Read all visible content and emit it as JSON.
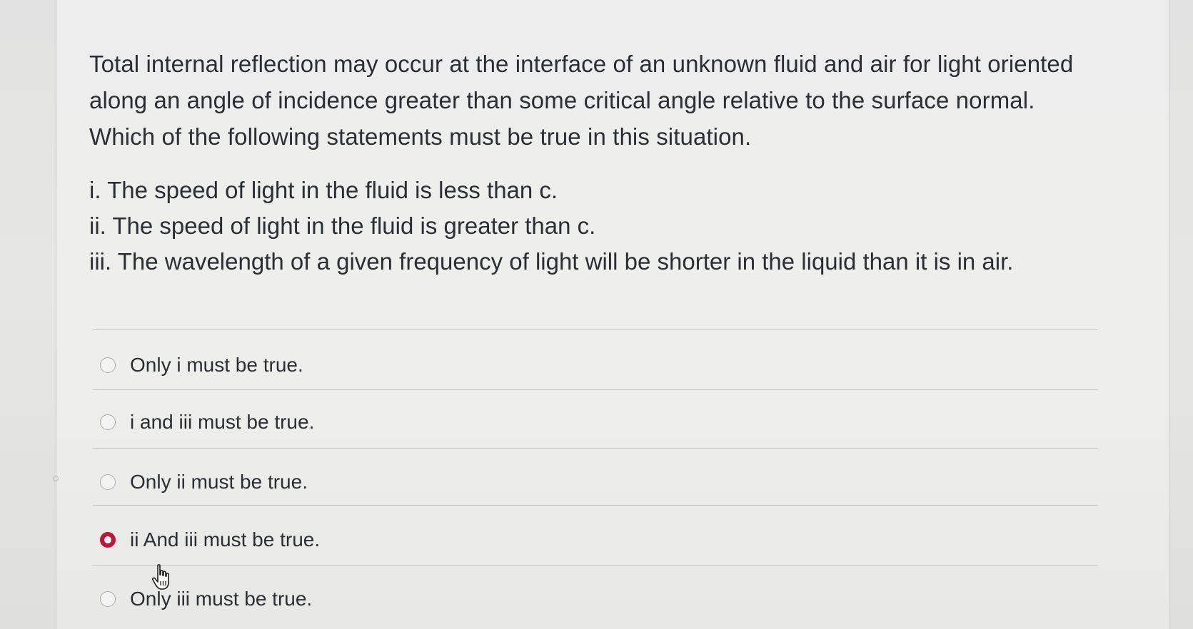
{
  "question": {
    "text": "Total internal reflection may occur at the interface of an unknown fluid and air for light oriented along an angle of incidence greater than some critical angle relative to the surface normal. Which of the following statements must be true in this situation.",
    "statements": [
      "i. The speed of light in the fluid is less than c.",
      "ii. The speed of light in the fluid is greater than c.",
      "iii. The wavelength of a given frequency of light will be shorter in the liquid than it is in air."
    ]
  },
  "answers": [
    {
      "label": "Only i must be true.",
      "selected": false
    },
    {
      "label": "i and iii must be true.",
      "selected": false
    },
    {
      "label": "Only ii must be true.",
      "selected": false
    },
    {
      "label": "ii And iii must be true.",
      "selected": true
    },
    {
      "label": "Only iii must be true.",
      "selected": false
    }
  ],
  "colors": {
    "accent": "#c1143a",
    "text": "#2b2f33",
    "background": "#ededed"
  },
  "icons": {
    "cursor": "hand-pointer-icon",
    "radio": "radio-button-icon"
  }
}
